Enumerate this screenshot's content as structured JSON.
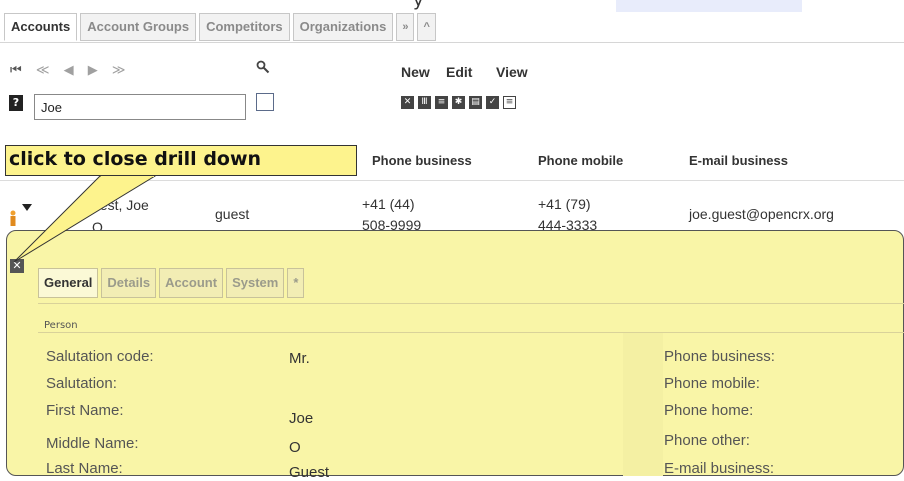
{
  "top_cut_text": "y",
  "tabs": [
    {
      "label": "Accounts",
      "active": true
    },
    {
      "label": "Account Groups",
      "active": false
    },
    {
      "label": "Competitors",
      "active": false
    },
    {
      "label": "Organizations",
      "active": false
    },
    {
      "label": "»",
      "active": false
    },
    {
      "label": "^",
      "active": false
    }
  ],
  "nav": {
    "first": "⏮",
    "prev_page": "≪",
    "prev": "◀",
    "next": "▶",
    "next_page": "≫"
  },
  "menu": {
    "new": "New",
    "edit": "Edit",
    "view": "View"
  },
  "search": {
    "help": "?",
    "value": "Joe"
  },
  "columns": {
    "phone_business": "Phone business",
    "phone_mobile": "Phone mobile",
    "email_business": "E-mail business"
  },
  "callout": {
    "text": "click to close drill down"
  },
  "row": {
    "name_line1": "uest, Joe",
    "name_line2": "O",
    "alias": "guest",
    "phone_business_1": "+41 (44)",
    "phone_business_2": "508-9999",
    "phone_mobile_1": "+41 (79)",
    "phone_mobile_2": "444-3333",
    "email": "joe.guest@opencrx.org"
  },
  "drilldown": {
    "tabs": [
      {
        "label": "General",
        "active": true
      },
      {
        "label": "Details",
        "active": false
      },
      {
        "label": "Account",
        "active": false
      },
      {
        "label": "System",
        "active": false
      },
      {
        "label": "*",
        "active": false
      }
    ],
    "section": "Person",
    "fields": [
      {
        "label": "Salutation code:",
        "value": "Mr."
      },
      {
        "label": "Salutation:",
        "value": ""
      },
      {
        "label": "First Name:",
        "value": "Joe"
      },
      {
        "label": "Middle Name:",
        "value": "O"
      },
      {
        "label": "Last Name:",
        "value": "Guest"
      }
    ],
    "right_fields": [
      "Phone business:",
      "Phone mobile:",
      "Phone home:",
      "Phone other:",
      "E-mail business:"
    ]
  }
}
